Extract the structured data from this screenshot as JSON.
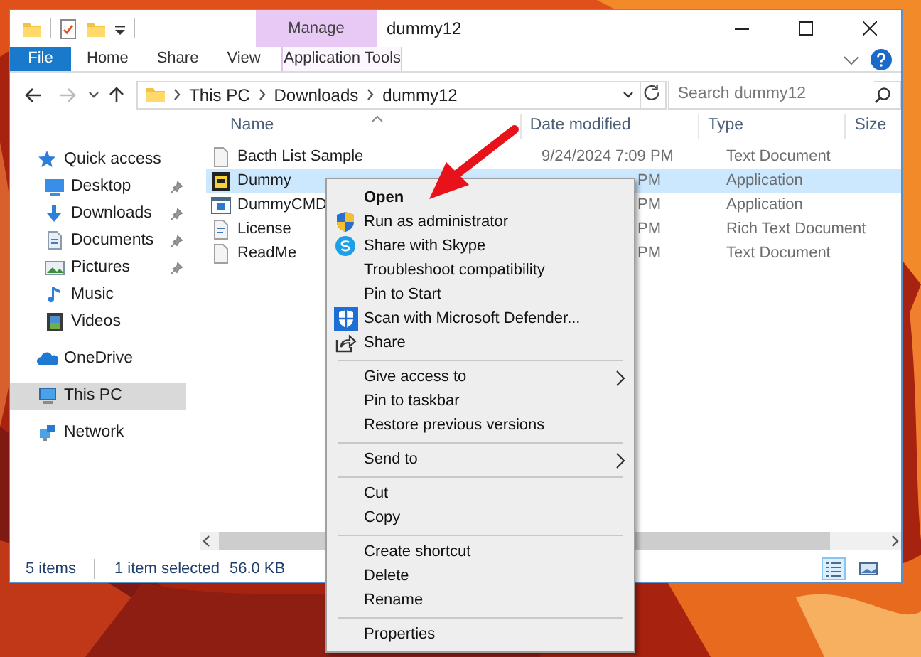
{
  "window": {
    "title": "dummy12",
    "contextual_group": "Manage"
  },
  "ribbon_tabs": [
    {
      "label": "File",
      "kind": "file"
    },
    {
      "label": "Home",
      "kind": "tab"
    },
    {
      "label": "Share",
      "kind": "tab"
    },
    {
      "label": "View",
      "kind": "tab"
    },
    {
      "label": "Application Tools",
      "kind": "contextual"
    }
  ],
  "navigation": {
    "forward_disabled": true
  },
  "address": {
    "path": [
      "This PC",
      "Downloads",
      "dummy12"
    ]
  },
  "search": {
    "placeholder": "Search dummy12"
  },
  "columns": [
    "Name",
    "Date modified",
    "Type",
    "Size"
  ],
  "sidebar": [
    {
      "label": "Quick access",
      "kind": "star",
      "selected": false,
      "children": [
        {
          "label": "Desktop",
          "kind": "desktop",
          "pinned": true,
          "selected": false
        },
        {
          "label": "Downloads",
          "kind": "download",
          "pinned": true,
          "selected": false
        },
        {
          "label": "Documents",
          "kind": "documents",
          "pinned": true,
          "selected": false
        },
        {
          "label": "Pictures",
          "kind": "pictures",
          "pinned": true,
          "selected": false
        },
        {
          "label": "Music",
          "kind": "music",
          "pinned": false,
          "selected": false
        },
        {
          "label": "Videos",
          "kind": "videos",
          "pinned": false,
          "selected": false
        }
      ]
    },
    {
      "label": "OneDrive",
      "kind": "cloud",
      "selected": false
    },
    {
      "label": "This PC",
      "kind": "pc",
      "selected": true
    },
    {
      "label": "Network",
      "kind": "network",
      "selected": false
    }
  ],
  "files": [
    {
      "name": "Bacth List Sample",
      "date": "9/24/2024 7:09 PM",
      "type": "Text Document",
      "kind": "text",
      "selected": false
    },
    {
      "name": "Dummy",
      "date": "PM",
      "type": "Application",
      "kind": "app",
      "selected": true
    },
    {
      "name": "DummyCMD",
      "date": "PM",
      "type": "Application",
      "kind": "console",
      "selected": false
    },
    {
      "name": "License",
      "date": "PM",
      "type": "Rich Text Document",
      "kind": "rtf",
      "selected": false
    },
    {
      "name": "ReadMe",
      "date": "PM",
      "type": "Text Document",
      "kind": "text",
      "selected": false
    }
  ],
  "status_bar": {
    "count": "5 items",
    "selection": "1 item selected",
    "size": "56.0 KB",
    "view_buttons": [
      {
        "selected": true
      },
      {
        "selected": false
      }
    ]
  },
  "context_menu": [
    {
      "kind": "command",
      "label": "Open",
      "default": true
    },
    {
      "kind": "command",
      "label": "Run as administrator"
    },
    {
      "kind": "command",
      "label": "Share with Skype"
    },
    {
      "kind": "command",
      "label": "Troubleshoot compatibility"
    },
    {
      "kind": "command",
      "label": "Pin to Start"
    },
    {
      "kind": "command",
      "label": "Scan with Microsoft Defender..."
    },
    {
      "kind": "command",
      "label": "Share"
    },
    {
      "kind": "separator"
    },
    {
      "kind": "command",
      "label": "Give access to",
      "submenu": true
    },
    {
      "kind": "command",
      "label": "Pin to taskbar"
    },
    {
      "kind": "command",
      "label": "Restore previous versions"
    },
    {
      "kind": "separator"
    },
    {
      "kind": "command",
      "label": "Send to",
      "submenu": true
    },
    {
      "kind": "separator"
    },
    {
      "kind": "command",
      "label": "Cut"
    },
    {
      "kind": "command",
      "label": "Copy"
    },
    {
      "kind": "separator"
    },
    {
      "kind": "command",
      "label": "Create shortcut"
    },
    {
      "kind": "command",
      "label": "Delete"
    },
    {
      "kind": "command",
      "label": "Rename"
    },
    {
      "kind": "separator"
    },
    {
      "kind": "command",
      "label": "Properties"
    }
  ]
}
